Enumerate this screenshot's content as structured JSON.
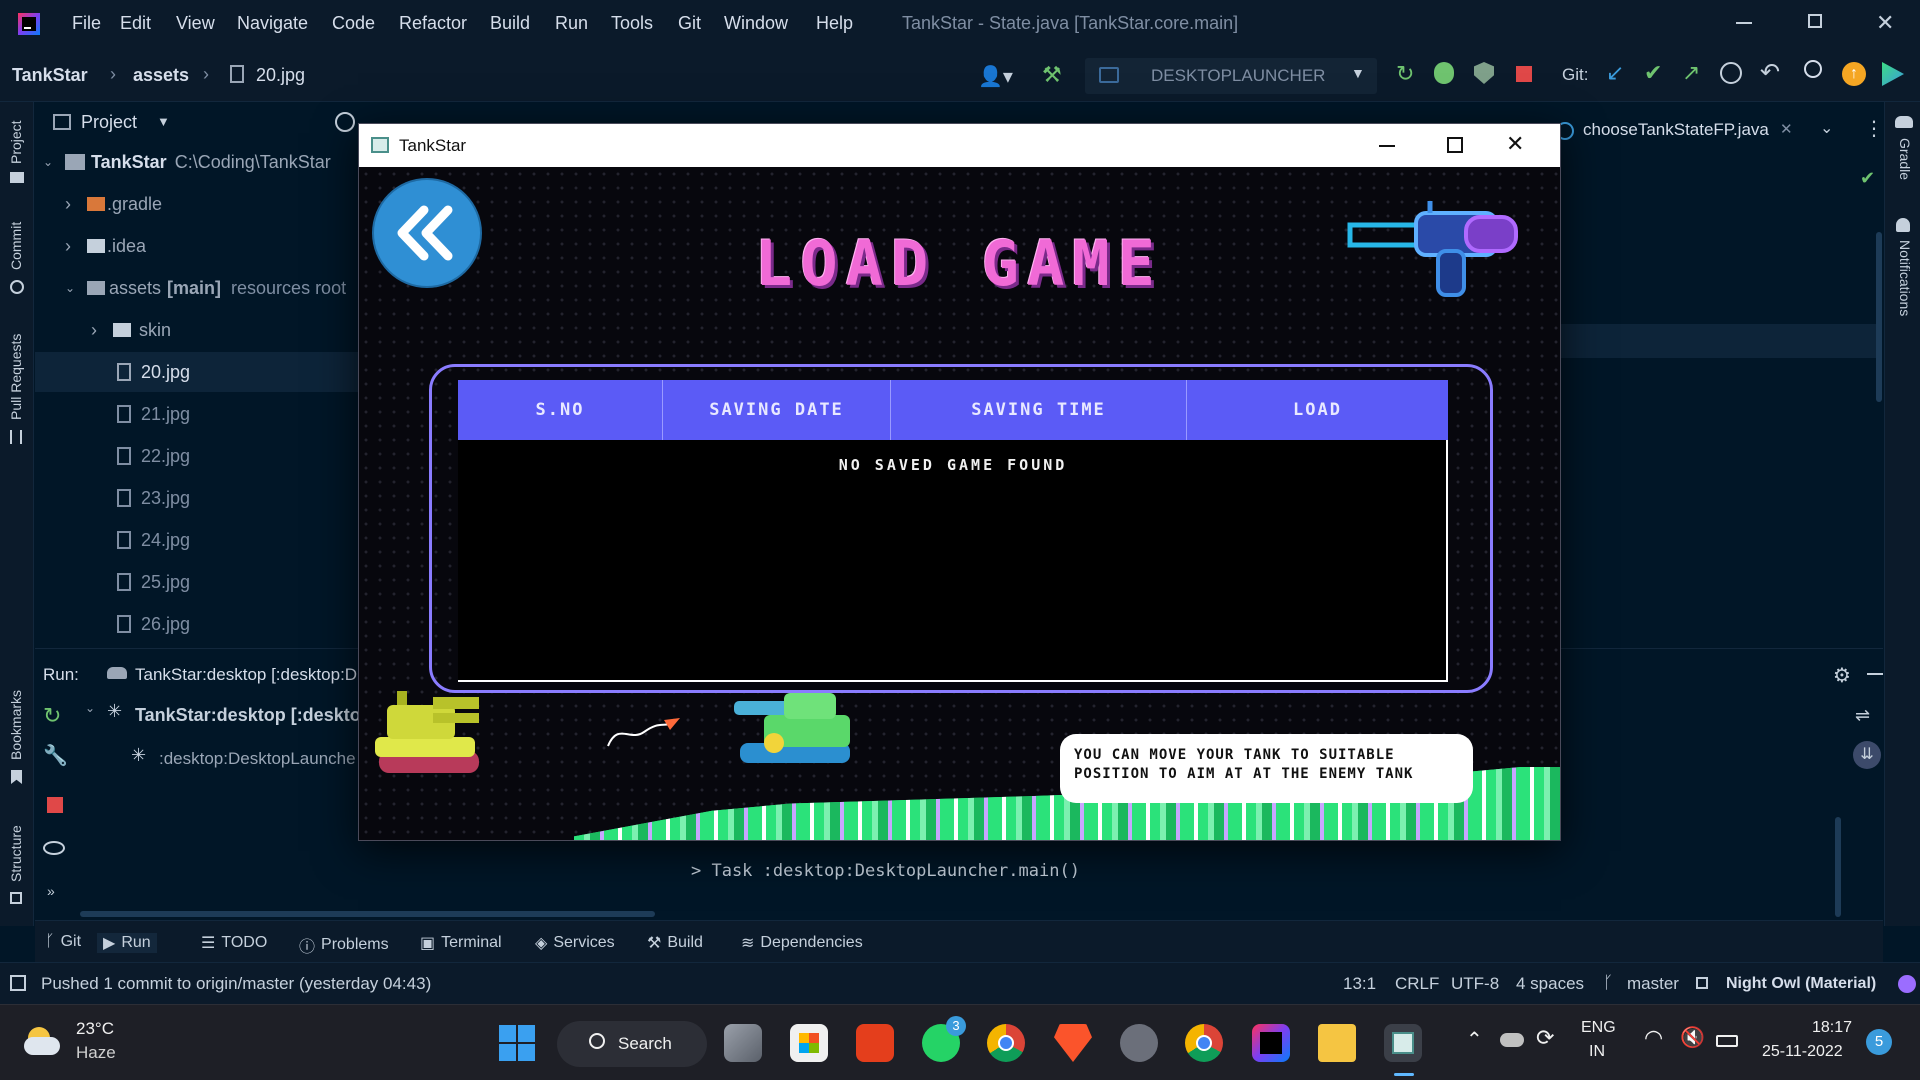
{
  "menu": [
    "File",
    "Edit",
    "View",
    "Navigate",
    "Code",
    "Refactor",
    "Build",
    "Run",
    "Tools",
    "Git",
    "Window",
    "Help"
  ],
  "window_title": "TankStar - State.java [TankStar.core.main]",
  "breadcrumb": {
    "project": "TankStar",
    "folder": "assets",
    "file": "20.jpg"
  },
  "run_config": "DESKTOPLAUNCHER",
  "git_label": "Git:",
  "side_tabs_left": [
    "Project",
    "Commit",
    "Pull Requests",
    "Bookmarks",
    "Structure"
  ],
  "side_tabs_right": [
    "Gradle",
    "Notifications"
  ],
  "project_panel": {
    "title": "Project",
    "root_name": "TankStar",
    "root_path": "C:\\Coding\\TankStar",
    "items": [
      {
        "label": "gradle",
        "prefix": ".",
        "type": "folder-orange"
      },
      {
        "label": "idea",
        "prefix": ".",
        "type": "folder"
      },
      {
        "label": "assets",
        "tag": "[main]",
        "extra": "resources root",
        "type": "folder-open"
      },
      {
        "label": "skin",
        "type": "folder"
      },
      {
        "label": "20.jpg",
        "type": "file"
      },
      {
        "label": "21.jpg",
        "type": "file"
      },
      {
        "label": "22.jpg",
        "type": "file"
      },
      {
        "label": "23.jpg",
        "type": "file"
      },
      {
        "label": "24.jpg",
        "type": "file"
      },
      {
        "label": "25.jpg",
        "type": "file"
      },
      {
        "label": "26.jpg",
        "type": "file"
      }
    ]
  },
  "editor_tab": "chooseTankStateFP.java",
  "run_panel": {
    "label": "Run:",
    "tab": "TankStar:desktop [:desktop:D",
    "tree_root": "TankStar:desktop [:deskto",
    "tree_child": ":desktop:DesktopLaunche"
  },
  "console_text": "> Task :desktop:DesktopLauncher.main()",
  "bottom_tools": [
    "Git",
    "Run",
    "TODO",
    "Problems",
    "Terminal",
    "Services",
    "Build",
    "Dependencies"
  ],
  "status": {
    "message": "Pushed 1 commit to origin/master (yesterday 04:43)",
    "position": "13:1",
    "line_sep": "CRLF",
    "encoding": "UTF-8",
    "indent": "4 spaces",
    "branch": "master",
    "theme": "Night Owl (Material)"
  },
  "game": {
    "window_title": "TankStar",
    "heading": "LOAD GAME",
    "columns": [
      "S.NO",
      "SAVING DATE",
      "SAVING TIME",
      "LOAD"
    ],
    "empty_message": "NO SAVED GAME FOUND",
    "hint_line1": "YOU CAN MOVE YOUR TANK TO SUITABLE",
    "hint_line2": "POSITION TO AIM AT AT THE ENEMY TANK",
    "colors": {
      "heading": "#f06ad6",
      "table_header": "#5b5bf6",
      "frame": "#8a7cff",
      "back_button": "#2f8fd4"
    }
  },
  "taskbar": {
    "weather_temp": "23°C",
    "weather_desc": "Haze",
    "search": "Search",
    "lang1": "ENG",
    "lang2": "IN",
    "time": "18:17",
    "date": "25-11-2022",
    "whatsapp_badge": "3",
    "notif_count": "5"
  }
}
